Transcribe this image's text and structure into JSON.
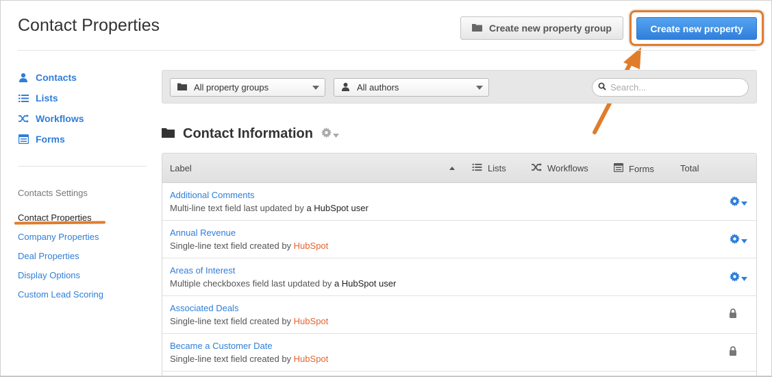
{
  "header": {
    "title": "Contact Properties",
    "create_group_label": "Create new property group",
    "create_property_label": "Create new property"
  },
  "sidebar": {
    "nav": [
      {
        "label": "Contacts",
        "icon": "person-icon"
      },
      {
        "label": "Lists",
        "icon": "list-icon"
      },
      {
        "label": "Workflows",
        "icon": "shuffle-icon"
      },
      {
        "label": "Forms",
        "icon": "form-icon"
      }
    ],
    "settings_title": "Contacts Settings",
    "settings_links": [
      {
        "label": "Contact Properties",
        "active": true
      },
      {
        "label": "Company Properties",
        "active": false
      },
      {
        "label": "Deal Properties",
        "active": false
      },
      {
        "label": "Display Options",
        "active": false
      },
      {
        "label": "Custom Lead Scoring",
        "active": false
      }
    ]
  },
  "filters": {
    "group_select": "All property groups",
    "author_select": "All authors",
    "search_placeholder": "Search..."
  },
  "group": {
    "title": "Contact Information"
  },
  "table": {
    "headers": {
      "label": "Label",
      "lists": "Lists",
      "workflows": "Workflows",
      "forms": "Forms",
      "total": "Total"
    },
    "rows": [
      {
        "name": "Additional Comments",
        "desc": "Multi-line text field last updated by",
        "by": "a HubSpot user",
        "by_style": "user",
        "action": "gear"
      },
      {
        "name": "Annual Revenue",
        "desc": "Single-line text field created by",
        "by": "HubSpot",
        "by_style": "hubspot",
        "action": "gear"
      },
      {
        "name": "Areas of Interest",
        "desc": "Multiple checkboxes field last updated by",
        "by": "a HubSpot user",
        "by_style": "user",
        "action": "gear"
      },
      {
        "name": "Associated Deals",
        "desc": "Single-line text field created by",
        "by": "HubSpot",
        "by_style": "hubspot",
        "action": "lock"
      },
      {
        "name": "Became a Customer Date",
        "desc": "Single-line text field created by",
        "by": "HubSpot",
        "by_style": "hubspot",
        "action": "lock"
      }
    ]
  },
  "colors": {
    "link": "#2f7ed8",
    "primary": "#2f7fdc",
    "annotation": "#e17c2b",
    "hubspot": "#e5632f"
  }
}
